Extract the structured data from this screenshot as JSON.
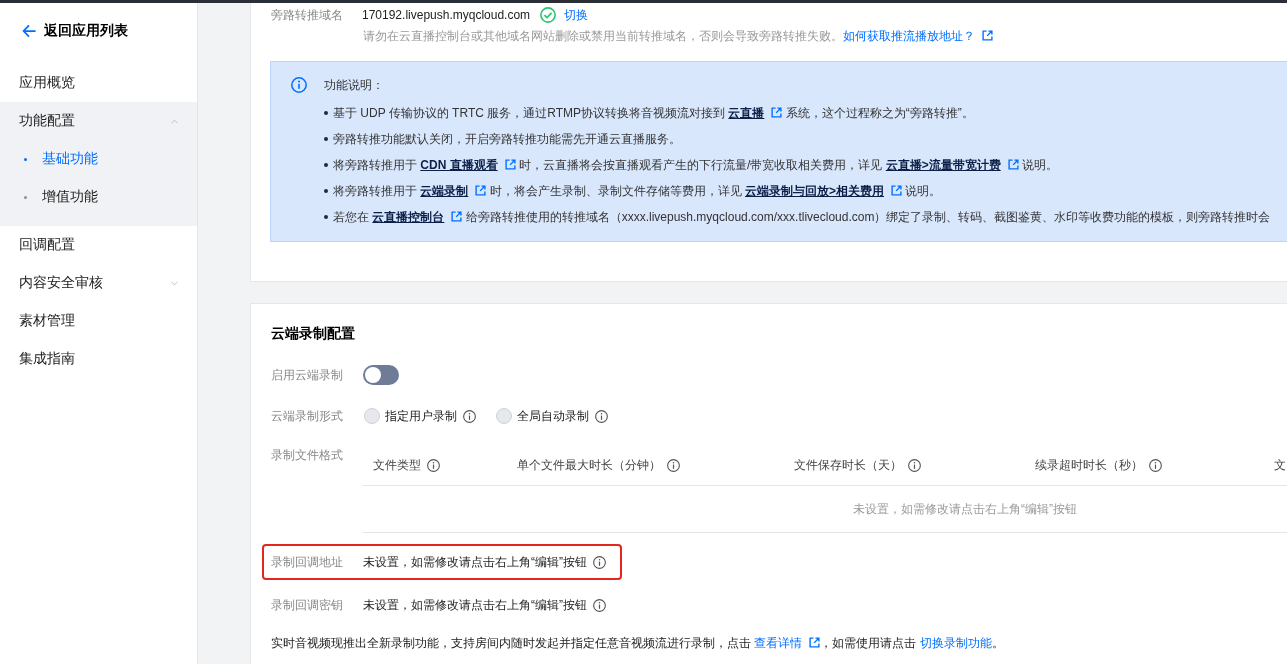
{
  "sidebar": {
    "back_link": "返回应用列表",
    "items": [
      {
        "kind": "item",
        "label": "应用概览",
        "selected": false
      },
      {
        "kind": "group",
        "label": "功能配置",
        "expanded": true,
        "children": [
          {
            "label": "基础功能",
            "selected": true
          },
          {
            "label": "增值功能",
            "selected": false
          }
        ]
      },
      {
        "kind": "item",
        "label": "回调配置",
        "selected": false
      },
      {
        "kind": "group",
        "label": "内容安全审核",
        "expanded": false
      },
      {
        "kind": "item",
        "label": "素材管理",
        "selected": false
      },
      {
        "kind": "item",
        "label": "集成指南",
        "selected": false
      }
    ]
  },
  "push_domain": {
    "label": "旁路转推域名",
    "value": "170192.livepush.myqcloud.com",
    "action": "切换",
    "hint": [
      {
        "kind": "text",
        "text": "请勿在云直播控制台或其他域名网站删除或禁用当前转推域名，否则会导致旁路转推失败。"
      },
      {
        "kind": "link",
        "text": "如何获取推流播放地址？",
        "external": true
      }
    ]
  },
  "notice": {
    "title": "功能说明：",
    "items": [
      {
        "segments": [
          {
            "kind": "text",
            "text": "基于 UDP 传输协议的 TRTC 服务，通过RTMP协议转换将音视频流对接到 "
          },
          {
            "kind": "link",
            "text": "云直播",
            "external": true
          },
          {
            "kind": "text",
            "text": " 系统，这个过程称之为“旁路转推”。"
          }
        ]
      },
      {
        "segments": [
          {
            "kind": "text",
            "text": "旁路转推功能默认关闭，开启旁路转推功能需先开通云直播服务。"
          }
        ]
      },
      {
        "segments": [
          {
            "kind": "text",
            "text": "将旁路转推用于 "
          },
          {
            "kind": "link",
            "text": "CDN 直播观看",
            "external": true
          },
          {
            "kind": "text",
            "text": " 时，云直播将会按直播观看产生的下行流量/带宽收取相关费用，详见 "
          },
          {
            "kind": "link",
            "text": "云直播>流量带宽计费",
            "external": true
          },
          {
            "kind": "text",
            "text": " 说明。"
          }
        ]
      },
      {
        "segments": [
          {
            "kind": "text",
            "text": "将旁路转推用于 "
          },
          {
            "kind": "link",
            "text": "云端录制",
            "external": true
          },
          {
            "kind": "text",
            "text": " 时，将会产生录制、录制文件存储等费用，详见 "
          },
          {
            "kind": "link",
            "text": "云端录制与回放>相关费用",
            "external": true
          },
          {
            "kind": "text",
            "text": " 说明。"
          }
        ]
      },
      {
        "segments": [
          {
            "kind": "text",
            "text": "若您在 "
          },
          {
            "kind": "link",
            "text": "云直播控制台",
            "external": true
          },
          {
            "kind": "text",
            "text": " 给旁路转推使用的转推域名（xxxx.livepush.myqcloud.com/xxx.tlivecloud.com）绑定了录制、转码、截图鉴黄、水印等收费功能的模板，则旁路转推时会"
          }
        ]
      }
    ]
  },
  "recording": {
    "title": "云端录制配置",
    "fields": [
      {
        "kind": "switch",
        "label": "启用云端录制",
        "on": false
      },
      {
        "kind": "radio",
        "label": "云端录制形式",
        "options": [
          {
            "label": "指定用户录制",
            "selected": false
          },
          {
            "label": "全局自动录制",
            "selected": false
          }
        ]
      },
      {
        "kind": "table",
        "label": "录制文件格式",
        "columns": [
          {
            "label": "文件类型",
            "info": true
          },
          {
            "label": "单个文件最大时长（分钟）",
            "info": true
          },
          {
            "label": "文件保存时长（天）",
            "info": true
          },
          {
            "label": "续录超时时长（秒）",
            "info": true
          },
          {
            "label": "文"
          }
        ],
        "empty_text": "未设置，如需修改请点击右上角“编辑”按钮"
      },
      {
        "kind": "text",
        "label": "录制回调地址",
        "value": "未设置，如需修改请点击右上角“编辑”按钮",
        "highlighted": true
      },
      {
        "kind": "text",
        "label": "录制回调密钥",
        "value": "未设置，如需修改请点击右上角“编辑”按钮",
        "highlighted": false
      }
    ],
    "footer": [
      {
        "kind": "text",
        "text": "实时音视频现推出全新录制功能，支持房间内随时发起并指定任意音视频流进行录制，点击 "
      },
      {
        "kind": "link",
        "text": "查看详情",
        "external": true
      },
      {
        "kind": "text",
        "text": "，如需使用请点击 "
      },
      {
        "kind": "link",
        "text": "切换录制功能",
        "external": false
      },
      {
        "kind": "text",
        "text": "。"
      }
    ]
  }
}
